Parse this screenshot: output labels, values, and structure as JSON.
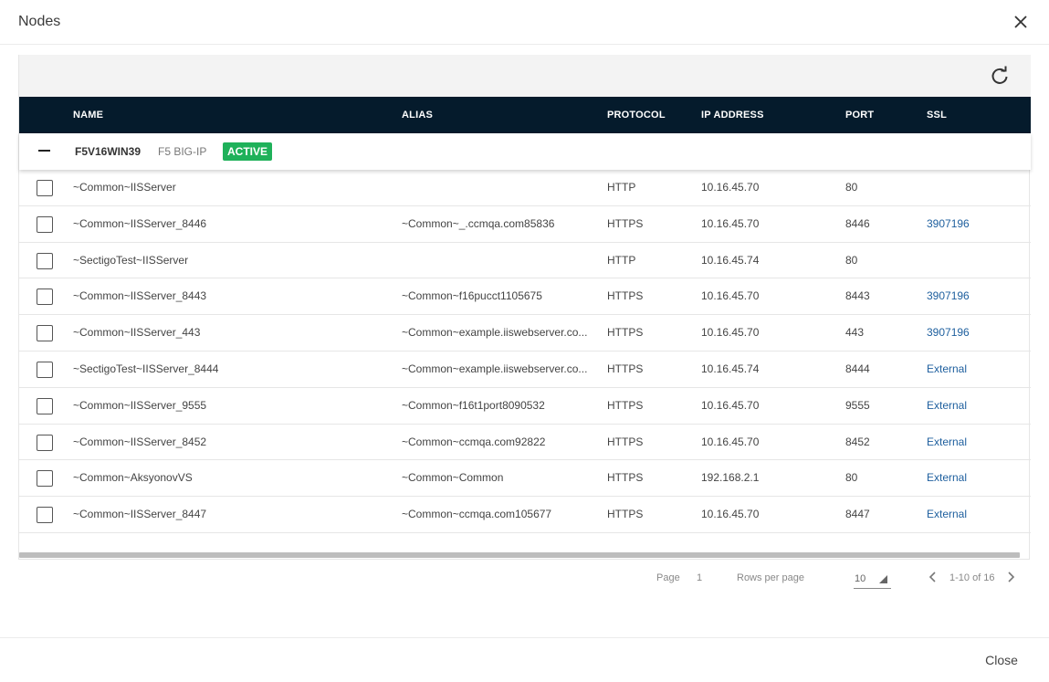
{
  "dialog": {
    "title": "Nodes",
    "close_label": "Close"
  },
  "columns": [
    "NAME",
    "ALIAS",
    "PROTOCOL",
    "IP ADDRESS",
    "PORT",
    "SSL"
  ],
  "group": {
    "name": "F5V16WIN39",
    "type": "F5 BIG-IP",
    "status": "ACTIVE",
    "status_color": "#1fb15a"
  },
  "rows": [
    {
      "name": "~Common~IISServer",
      "alias": "",
      "protocol": "HTTP",
      "ip": "10.16.45.70",
      "port": "80",
      "ssl": ""
    },
    {
      "name": "~Common~IISServer_8446",
      "alias": "~Common~_.ccmqa.com85836",
      "protocol": "HTTPS",
      "ip": "10.16.45.70",
      "port": "8446",
      "ssl": "3907196"
    },
    {
      "name": "~SectigoTest~IISServer",
      "alias": "",
      "protocol": "HTTP",
      "ip": "10.16.45.74",
      "port": "80",
      "ssl": ""
    },
    {
      "name": "~Common~IISServer_8443",
      "alias": "~Common~f16pucct1105675",
      "protocol": "HTTPS",
      "ip": "10.16.45.70",
      "port": "8443",
      "ssl": "3907196"
    },
    {
      "name": "~Common~IISServer_443",
      "alias": "~Common~example.iiswebserver.co...",
      "protocol": "HTTPS",
      "ip": "10.16.45.70",
      "port": "443",
      "ssl": "3907196"
    },
    {
      "name": "~SectigoTest~IISServer_8444",
      "alias": "~Common~example.iiswebserver.co...",
      "protocol": "HTTPS",
      "ip": "10.16.45.74",
      "port": "8444",
      "ssl": "External"
    },
    {
      "name": "~Common~IISServer_9555",
      "alias": "~Common~f16t1port8090532",
      "protocol": "HTTPS",
      "ip": "10.16.45.70",
      "port": "9555",
      "ssl": "External"
    },
    {
      "name": "~Common~IISServer_8452",
      "alias": "~Common~ccmqa.com92822",
      "protocol": "HTTPS",
      "ip": "10.16.45.70",
      "port": "8452",
      "ssl": "External"
    },
    {
      "name": "~Common~AksyonovVS",
      "alias": "~Common~Common",
      "protocol": "HTTPS",
      "ip": "192.168.2.1",
      "port": "80",
      "ssl": "External"
    },
    {
      "name": "~Common~IISServer_8447",
      "alias": "~Common~ccmqa.com105677",
      "protocol": "HTTPS",
      "ip": "10.16.45.70",
      "port": "8447",
      "ssl": "External"
    }
  ],
  "pagination": {
    "page_label": "Page",
    "page": "1",
    "rows_per_page_label": "Rows per page",
    "rows_per_page": "10",
    "range": "1-10 of 16"
  },
  "icons": {
    "close": "close-icon",
    "refresh": "refresh-icon",
    "collapse": "minus-icon",
    "prev": "chevron-left-icon",
    "next": "chevron-right-icon"
  }
}
